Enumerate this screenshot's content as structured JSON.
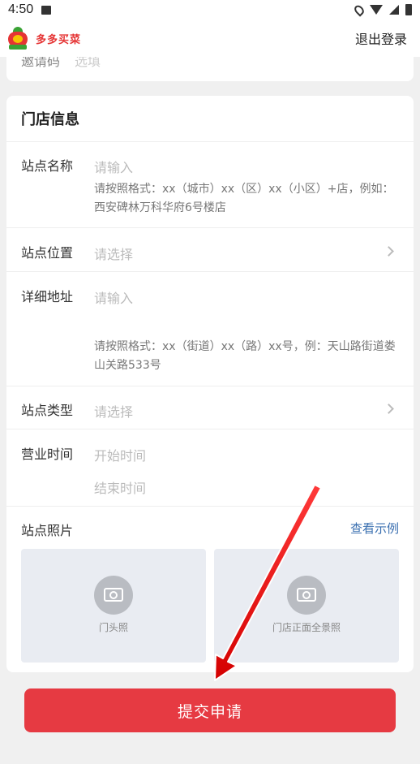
{
  "status_bar": {
    "time": "4:50"
  },
  "header": {
    "brand": "多多买菜",
    "logout": "退出登录"
  },
  "top_card": {
    "label": "邀请码",
    "placeholder": "选填"
  },
  "store_info": {
    "title": "门店信息",
    "fields": [
      {
        "label": "站点名称",
        "placeholder": "请输入",
        "hint": "请按照格式：xx（城市）xx（区）xx（小区）+店，例如：西安碑林万科华府6号楼店"
      },
      {
        "label": "站点位置",
        "placeholder": "请选择"
      },
      {
        "label": "详细地址",
        "placeholder": "请输入",
        "hint": "请按照格式：xx（街道）xx（路）xx号，例：天山路街道娄山关路533号"
      },
      {
        "label": "站点类型",
        "placeholder": "请选择"
      },
      {
        "label": "营业时间",
        "start_placeholder": "开始时间",
        "end_placeholder": "结束时间"
      }
    ],
    "photos": {
      "label": "站点照片",
      "example_link": "查看示例",
      "items": [
        {
          "caption": "门头照"
        },
        {
          "caption": "门店正面全景照"
        }
      ]
    }
  },
  "submit": {
    "label": "提交申请"
  },
  "colors": {
    "accent": "#e63a42",
    "link": "#3a6fb0",
    "brand_green": "#3aa335"
  }
}
